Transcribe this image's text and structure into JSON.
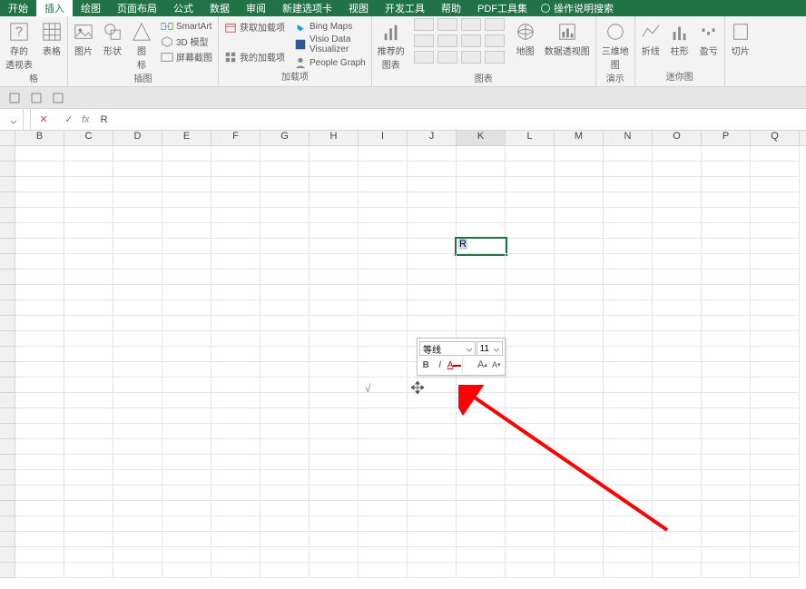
{
  "menubar": {
    "tabs": [
      "开始",
      "插入",
      "绘图",
      "页面布局",
      "公式",
      "数据",
      "审阅",
      "新建选项卡",
      "视图",
      "开发工具",
      "帮助",
      "PDF工具集"
    ],
    "active_index": 1,
    "search_hint": "操作说明搜索"
  },
  "ribbon": {
    "g0": {
      "label": "格",
      "b1": "存的\n透视表",
      "b2": "表格"
    },
    "g1": {
      "label": "插图",
      "b1": "图片",
      "b2": "形状",
      "b3": "图\n标",
      "s1": "SmartArt",
      "s2": "3D 模型",
      "s3": "屏幕截图"
    },
    "g2": {
      "label": "加载项",
      "s1": "获取加载项",
      "s2": "我的加载项",
      "bx1": "Bing Maps",
      "bx2": "Visio Data\nVisualizer",
      "bx3": "People Graph"
    },
    "g3": {
      "label": "图表",
      "b1": "推荐的\n图表",
      "b2": "地图",
      "b3": "数据透视图"
    },
    "g4": {
      "label": "演示",
      "b1": "三维地\n图"
    },
    "g5": {
      "label": "迷你图",
      "b1": "折线",
      "b2": "柱形",
      "b3": "盈亏"
    },
    "g6": {
      "b1": "切片"
    }
  },
  "formula_bar": {
    "cell_ref": "",
    "value": "R"
  },
  "columns": [
    "B",
    "C",
    "D",
    "E",
    "F",
    "G",
    "H",
    "I",
    "J",
    "K",
    "L",
    "M",
    "N",
    "O",
    "P",
    "Q"
  ],
  "selected_col_index": 9,
  "editing_cell": {
    "value": "R"
  },
  "mini": {
    "font": "等线",
    "size": "11",
    "b": "B",
    "i": "I",
    "u": "A",
    "inc": "A",
    "dec": "A"
  },
  "checkmark": "√"
}
